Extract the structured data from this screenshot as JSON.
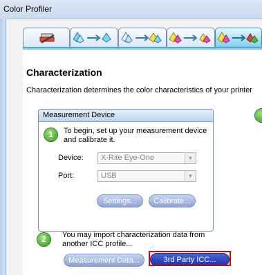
{
  "window": {
    "title": "Color Profiler"
  },
  "tabs": [
    {
      "icon": "printer-tray-icon"
    },
    {
      "icon": "color-droplets-arrow-icon"
    },
    {
      "icon": "color-droplets-arrow-icon"
    },
    {
      "icon": "color-droplets-arrow-icon"
    },
    {
      "icon": "color-droplets-arrow-icon",
      "active": true
    }
  ],
  "section": {
    "title": "Characterization",
    "description": "Characterization determines the color characteristics of your printer"
  },
  "measurement": {
    "header": "Measurement Device",
    "step_number": "1",
    "instruction_line1": "To begin, set up your measurement device",
    "instruction_line2": "and calibrate it.",
    "device_label": "Device:",
    "device_value": "X-Rite Eye-One",
    "port_label": "Port:",
    "port_value": "USB",
    "settings_button": "Settings...",
    "calibrate_button": "Calibrate..."
  },
  "import": {
    "step_number": "2",
    "instruction_line1": "You may import characterization data from",
    "instruction_line2": "another ICC profile...",
    "measurement_button": "Measurement Data...",
    "third_party_button": "3rd Party ICC..."
  },
  "colors": {
    "accent": "#1a35b5",
    "highlight": "#e00000",
    "step_green": "#2f9a20"
  }
}
